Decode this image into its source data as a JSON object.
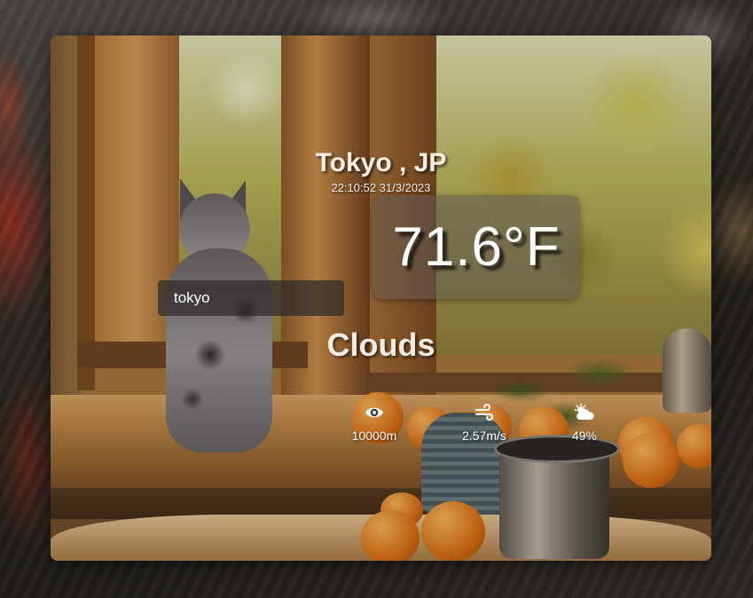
{
  "search": {
    "value": "tokyo"
  },
  "weather": {
    "location": "Tokyo , JP",
    "datetime": "22:10:52 31/3/2023",
    "temperature": "71.6°F",
    "condition": "Clouds",
    "visibility": "10000m",
    "wind_speed": "2.57m/s",
    "humidity": "49%"
  },
  "icons": {
    "visibility": "eye-icon",
    "wind": "wind-icon",
    "humidity": "cloud-sun-icon"
  },
  "colors": {
    "text": "#ffffff",
    "temp_box": "#5f5852",
    "search_bg": "#2d2a28"
  }
}
